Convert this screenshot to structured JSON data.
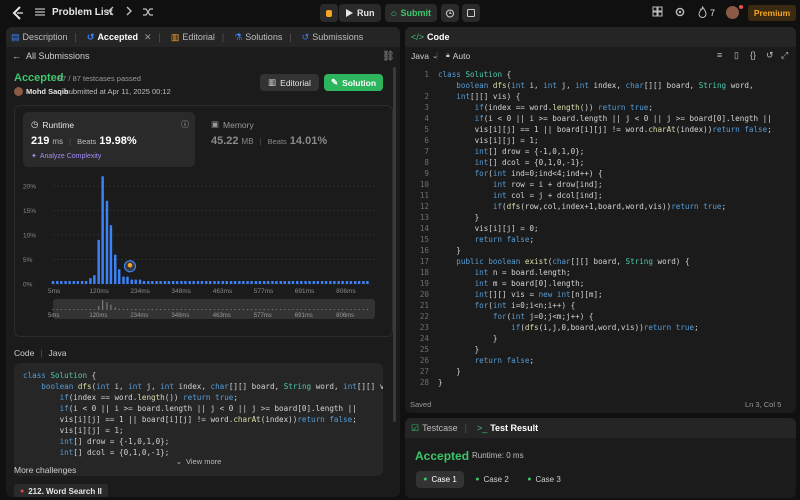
{
  "topbar": {
    "problem_list": "Problem List",
    "run": "Run",
    "submit": "Submit",
    "streak": "7",
    "premium": "Premium"
  },
  "left_tabs": {
    "description": "Description",
    "accepted": "Accepted",
    "editorial": "Editorial",
    "solutions": "Solutions",
    "submissions": "Submissions"
  },
  "submission": {
    "back": "All Submissions",
    "status": "Accepted",
    "testcases": "87 / 87 testcases passed",
    "user": "Mohd Saqib",
    "submitted": "submitted at Apr 11, 2025 00:12",
    "editorial_btn": "Editorial",
    "solution_btn": "Solution"
  },
  "runtime": {
    "label": "Runtime",
    "value": "219",
    "unit": "ms",
    "beats_label": "Beats",
    "beats": "19.98%",
    "analyze": "Analyze Complexity"
  },
  "memory": {
    "label": "Memory",
    "value": "45.22",
    "unit": "MB",
    "beats_label": "Beats",
    "beats": "14.01%"
  },
  "chart_data": {
    "type": "bar",
    "title": "",
    "xlabel": "",
    "ylabel": "",
    "ylim": [
      0,
      20
    ],
    "y_ticks": [
      "20%",
      "15%",
      "10%",
      "5%",
      "0%"
    ],
    "x_ticks": [
      "5ms",
      "120ms",
      "234ms",
      "348ms",
      "463ms",
      "577ms",
      "691ms",
      "806ms"
    ],
    "xlim": [
      5,
      900
    ],
    "bar_width_ms": 11.5,
    "x": [
      5,
      17,
      28,
      40,
      51,
      63,
      74,
      86,
      97,
      109,
      120,
      132,
      143,
      155,
      166,
      178,
      189,
      201,
      212,
      224,
      235,
      247,
      258,
      270,
      281,
      293,
      304,
      316,
      327,
      339,
      350,
      362,
      373,
      385,
      396,
      408,
      419,
      431,
      442,
      454,
      465,
      477,
      488,
      500,
      511,
      523,
      534,
      546,
      557,
      569,
      580,
      592,
      603,
      615,
      626,
      638,
      649,
      661,
      672,
      684,
      695,
      707,
      718,
      730,
      741,
      753,
      764,
      776,
      787,
      799,
      810,
      822,
      833,
      845,
      856,
      868,
      879
    ],
    "values": [
      0.6,
      0.6,
      0.6,
      0.6,
      0.6,
      0.6,
      0.6,
      0.6,
      0.6,
      1.2,
      1.8,
      9,
      22,
      17,
      12,
      6,
      3,
      1.5,
      1.5,
      0.9,
      0.9,
      0.9,
      0.6,
      0.6,
      0.6,
      0.6,
      0.6,
      0.6,
      0.6,
      0.6,
      0.6,
      0.6,
      0.6,
      0.6,
      0.6,
      0.6,
      0.6,
      0.6,
      0.6,
      0.6,
      0.6,
      0.6,
      0.6,
      0.6,
      0.6,
      0.6,
      0.6,
      0.6,
      0.6,
      0.6,
      0.6,
      0.6,
      0.6,
      0.6,
      0.6,
      0.6,
      0.6,
      0.6,
      0.6,
      0.6,
      0.6,
      0.6,
      0.6,
      0.6,
      0.6,
      0.6,
      0.6,
      0.6,
      0.6,
      0.6,
      0.6,
      0.6,
      0.6,
      0.6,
      0.6,
      0.6,
      0.6
    ],
    "highlight_x": 219,
    "bar_color": "#3b82f6",
    "highlight_color": "#f5a623"
  },
  "code_section": {
    "label": "Code",
    "lang": "Java",
    "view_more": "View more",
    "lines": [
      "class Solution {",
      "    boolean dfs(int i, int j, int index, char[][] board, String word, int[][] vis",
      "        if(index == word.length()) return true;",
      "        if(i < 0 || i >= board.length || j < 0 || j >= board[0].length ||",
      "        vis[i][j] == 1 || board[i][j] != word.charAt(index))return false;",
      "        vis[i][j] = 1;",
      "        int[] drow = {-1,0,1,0};",
      "        int[] dcol = {0,1,0,-1};"
    ]
  },
  "more": {
    "label": "More challenges",
    "item": "212. Word Search II"
  },
  "editor": {
    "title": "Code",
    "lang": "Java",
    "auto": "Auto",
    "saved": "Saved",
    "cursor": "Ln 3, Col 5",
    "lines": [
      "class Solution {",
      "    boolean dfs(int i, int j, int index, char[][] board, String word,",
      "    int[][] vis) {",
      "        if(index == word.length()) return true;",
      "        if(i < 0 || i >= board.length || j < 0 || j >= board[0].length ||",
      "        vis[i][j] == 1 || board[i][j] != word.charAt(index))return false;",
      "        vis[i][j] = 1;",
      "        int[] drow = {-1,0,1,0};",
      "        int[] dcol = {0,1,0,-1};",
      "        for(int ind=0;ind<4;ind++) {",
      "            int row = i + drow[ind];",
      "            int col = j + dcol[ind];",
      "            if(dfs(row,col,index+1,board,word,vis))return true;",
      "        }",
      "        vis[i][j] = 0;",
      "        return false;",
      "    }",
      "    public boolean exist(char[][] board, String word) {",
      "        int n = board.length;",
      "        int m = board[0].length;",
      "        int[][] vis = new int[n][m];",
      "        for(int i=0;i<n;i++) {",
      "            for(int j=0;j<m;j++) {",
      "                if(dfs(i,j,0,board,word,vis))return true;",
      "            }",
      "        }",
      "        return false;",
      "    }",
      "}"
    ],
    "line_numbers": [
      "1",
      "",
      "2",
      "3",
      "4",
      "5",
      "6",
      "7",
      "8",
      "9",
      "10",
      "11",
      "12",
      "13",
      "14",
      "15",
      "16",
      "17",
      "18",
      "19",
      "20",
      "21",
      "22",
      "23",
      "24",
      "25",
      "26",
      "27",
      "28"
    ]
  },
  "result": {
    "testcase_tab": "Testcase",
    "result_tab": "Test Result",
    "status": "Accepted",
    "runtime": "Runtime: 0 ms",
    "cases": [
      "Case 1",
      "Case 2",
      "Case 3"
    ]
  },
  "colors": {
    "accent_green": "#3cc66a",
    "bg": "#101010",
    "panel": "#1b1b1b",
    "premium": "#f5a623"
  }
}
